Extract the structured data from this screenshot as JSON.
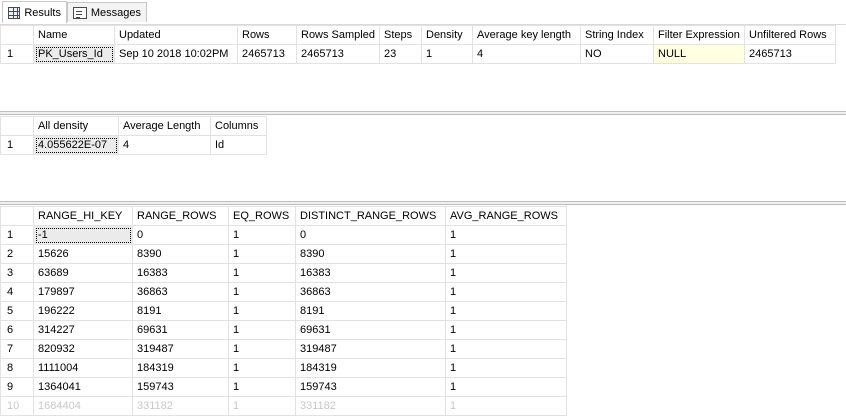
{
  "tabs": [
    {
      "label": "Results",
      "icon": "grid-icon",
      "active": true
    },
    {
      "label": "Messages",
      "icon": "messages-icon",
      "active": false
    }
  ],
  "grid1": {
    "headers": [
      "",
      "Name",
      "Updated",
      "Rows",
      "Rows Sampled",
      "Steps",
      "Density",
      "Average key length",
      "String Index",
      "Filter Expression",
      "Unfiltered Rows"
    ],
    "rows": [
      [
        "1",
        "PK_Users_Id",
        "Sep 10 2018 10:02PM",
        "2465713",
        "2465713",
        "23",
        "1",
        "4",
        "NO",
        "NULL",
        "2465713"
      ]
    ]
  },
  "grid2": {
    "headers": [
      "",
      "All density",
      "Average Length",
      "Columns"
    ],
    "rows": [
      [
        "1",
        "4.055622E-07",
        "4",
        "Id"
      ]
    ]
  },
  "grid3": {
    "headers": [
      "",
      "RANGE_HI_KEY",
      "RANGE_ROWS",
      "EQ_ROWS",
      "DISTINCT_RANGE_ROWS",
      "AVG_RANGE_ROWS"
    ],
    "rows": [
      [
        "1",
        "-1",
        "0",
        "1",
        "0",
        "1"
      ],
      [
        "2",
        "15626",
        "8390",
        "1",
        "8390",
        "1"
      ],
      [
        "3",
        "63689",
        "16383",
        "1",
        "16383",
        "1"
      ],
      [
        "4",
        "179897",
        "36863",
        "1",
        "36863",
        "1"
      ],
      [
        "5",
        "196222",
        "8191",
        "1",
        "8191",
        "1"
      ],
      [
        "6",
        "314227",
        "69631",
        "1",
        "69631",
        "1"
      ],
      [
        "7",
        "820932",
        "319487",
        "1",
        "319487",
        "1"
      ],
      [
        "8",
        "1111004",
        "184319",
        "1",
        "184319",
        "1"
      ],
      [
        "9",
        "1364041",
        "159743",
        "1",
        "159743",
        "1"
      ],
      [
        "10",
        "1684404",
        "331182",
        "1",
        "331182",
        "1"
      ]
    ]
  }
}
